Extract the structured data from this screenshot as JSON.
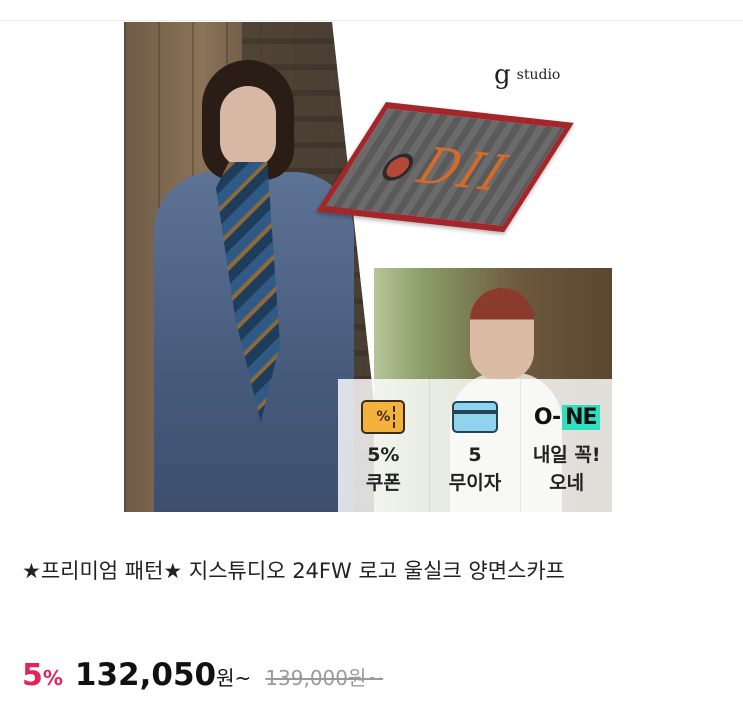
{
  "hero": {
    "brand_logo": "g",
    "brand_name": "studio",
    "scarf_letters": "DII"
  },
  "badges": [
    {
      "icon": "coupon-icon",
      "icon_text": "%",
      "line1": "5%",
      "line2": "쿠폰"
    },
    {
      "icon": "card-icon",
      "line1": "5",
      "line2": "무이자"
    },
    {
      "icon": "o-ne-logo-icon",
      "logo_a": "O-",
      "logo_b": "NE",
      "line1": "내일 꼭!",
      "line2": "오네"
    }
  ],
  "product": {
    "title": "★프리미엄 패턴★ 지스튜디오 24FW 로고 울실크 양면스카프",
    "discount_rate": "5",
    "discount_sign": "%",
    "price": "132,050",
    "price_unit": "원~",
    "original_price": "139,000원~"
  },
  "colors": {
    "discount": "#e0245e",
    "coupon_icon": "#f3b23b",
    "card_icon": "#8fd3ef",
    "one_logo": "#2ee0c0"
  }
}
